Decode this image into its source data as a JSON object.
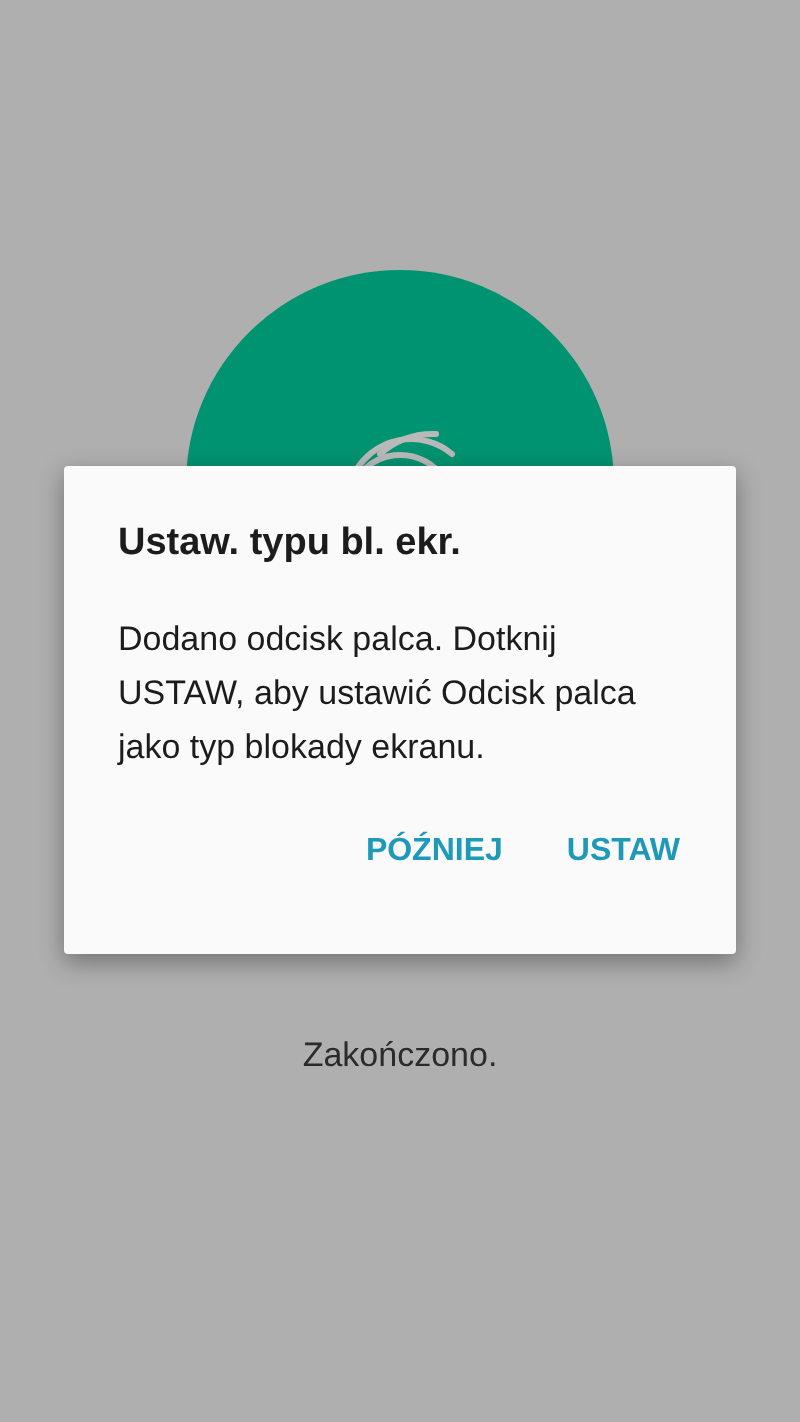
{
  "dialog": {
    "title": "Ustaw. typu bl. ekr.",
    "message": "Dodano odcisk palca. Dotknij USTAW, aby ustawić Odcisk palca jako typ blokady ekranu.",
    "buttons": [
      "PÓŹNIEJ",
      "USTAW"
    ]
  },
  "status": "Zakończono."
}
